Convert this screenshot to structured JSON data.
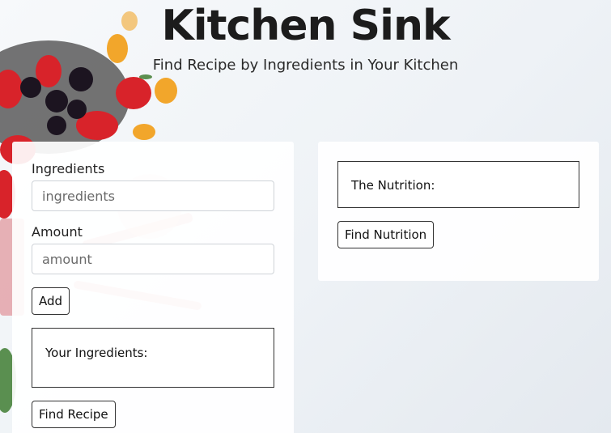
{
  "header": {
    "title": "Kitchen Sink",
    "subtitle": "Find Recipe by Ingredients in Your Kitchen"
  },
  "left_panel": {
    "ingredients_label": "Ingredients",
    "ingredients_placeholder": "ingredients",
    "amount_label": "Amount",
    "amount_placeholder": "amount",
    "add_button": "Add",
    "your_ingredients_label": "Your Ingredients:",
    "find_recipe_button": "Find Recipe"
  },
  "right_panel": {
    "nutrition_label": "The Nutrition:",
    "find_nutrition_button": "Find Nutrition"
  }
}
